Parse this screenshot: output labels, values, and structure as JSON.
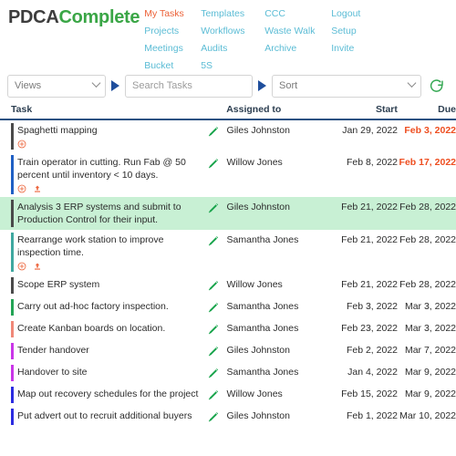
{
  "brand": {
    "name_part1": "PDCA",
    "name_part2": "Complete",
    "color_dark": "#3d3d3d",
    "color_green": "#3aa646"
  },
  "nav": {
    "active_color": "#ec6137",
    "link_color": "#5bbcd5",
    "columns": [
      {
        "items": [
          "My Tasks",
          "Projects",
          "Meetings",
          "Bucket"
        ]
      },
      {
        "items": [
          "Templates",
          "Workflows",
          "Audits",
          "5S"
        ]
      },
      {
        "items": [
          "CCC",
          "Waste Walk",
          "Archive"
        ]
      },
      {
        "items": [
          "Logout",
          "Setup",
          "Invite"
        ]
      }
    ],
    "active_item": "My Tasks"
  },
  "toolbar": {
    "views_label": "Views",
    "search_placeholder": "Search Tasks",
    "search_value": "",
    "sort_label": "Sort",
    "play_icon": "play-triangle-icon",
    "refresh_icon": "refresh-icon",
    "refresh_color": "#35a853",
    "triangle_color": "#1f4e9c"
  },
  "table": {
    "headers": {
      "task": "Task",
      "assigned": "Assigned to",
      "start": "Start",
      "due": "Due"
    },
    "rows": [
      {
        "task": "Spaghetti mapping",
        "assigned": "Giles Johnston",
        "start": "Jan 29, 2022",
        "due": "Feb 3, 2022",
        "overdue": true,
        "bar_color": "#4a4a4a",
        "highlight": false,
        "icons": [
          "add-circle-icon"
        ]
      },
      {
        "task": "Train operator in cutting. Run Fab @ 50 percent until inventory < 10 days.",
        "assigned": "Willow Jones",
        "start": "Feb 8, 2022",
        "due": "Feb 17, 2022",
        "overdue": true,
        "bar_color": "#1f5fc4",
        "highlight": false,
        "icons": [
          "add-circle-icon",
          "upload-icon"
        ]
      },
      {
        "task": "Analysis 3 ERP systems and submit to Production Control for their input.",
        "assigned": "Giles Johnston",
        "start": "Feb 21, 2022",
        "due": "Feb 28, 2022",
        "overdue": false,
        "bar_color": "#4a4a4a",
        "highlight": true,
        "icons": []
      },
      {
        "task": "Rearrange work station to improve inspection time.",
        "assigned": "Samantha Jones",
        "start": "Feb 21, 2022",
        "due": "Feb 28, 2022",
        "overdue": false,
        "bar_color": "#3fa8a0",
        "highlight": false,
        "icons": [
          "add-circle-icon",
          "upload-icon"
        ]
      },
      {
        "task": "Scope ERP system",
        "assigned": "Willow Jones",
        "start": "Feb 21, 2022",
        "due": "Feb 28, 2022",
        "overdue": false,
        "bar_color": "#4a4a4a",
        "highlight": false,
        "icons": []
      },
      {
        "task": "Carry out ad-hoc factory inspection.",
        "assigned": "Samantha Jones",
        "start": "Feb 3, 2022",
        "due": "Mar 3, 2022",
        "overdue": false,
        "bar_color": "#23a455",
        "highlight": false,
        "icons": []
      },
      {
        "task": "Create Kanban boards on location.",
        "assigned": "Samantha Jones",
        "start": "Feb 23, 2022",
        "due": "Mar 3, 2022",
        "overdue": false,
        "bar_color": "#f08878",
        "highlight": false,
        "icons": []
      },
      {
        "task": "Tender handover",
        "assigned": "Giles Johnston",
        "start": "Feb 2, 2022",
        "due": "Mar 7, 2022",
        "overdue": false,
        "bar_color": "#c936e8",
        "highlight": false,
        "icons": []
      },
      {
        "task": "Handover to site",
        "assigned": "Samantha Jones",
        "start": "Jan 4, 2022",
        "due": "Mar 9, 2022",
        "overdue": false,
        "bar_color": "#c936e8",
        "highlight": false,
        "icons": []
      },
      {
        "task": "Map out recovery schedules for the project",
        "assigned": "Willow Jones",
        "start": "Feb 15, 2022",
        "due": "Mar 9, 2022",
        "overdue": false,
        "bar_color": "#2c2ce0",
        "highlight": false,
        "icons": []
      },
      {
        "task": "Put advert out to recruit additional buyers",
        "assigned": "Giles Johnston",
        "start": "Feb 1, 2022",
        "due": "Mar 10, 2022",
        "overdue": false,
        "bar_color": "#2c2ce0",
        "highlight": false,
        "icons": []
      }
    ],
    "edit_icon": "pencil-icon",
    "edit_icon_color": "#17a34a",
    "icon_color": "#ec6137",
    "header_rule_color": "#2c5282",
    "highlight_color": "#c8f0d4",
    "overdue_color": "#ee4e20"
  }
}
